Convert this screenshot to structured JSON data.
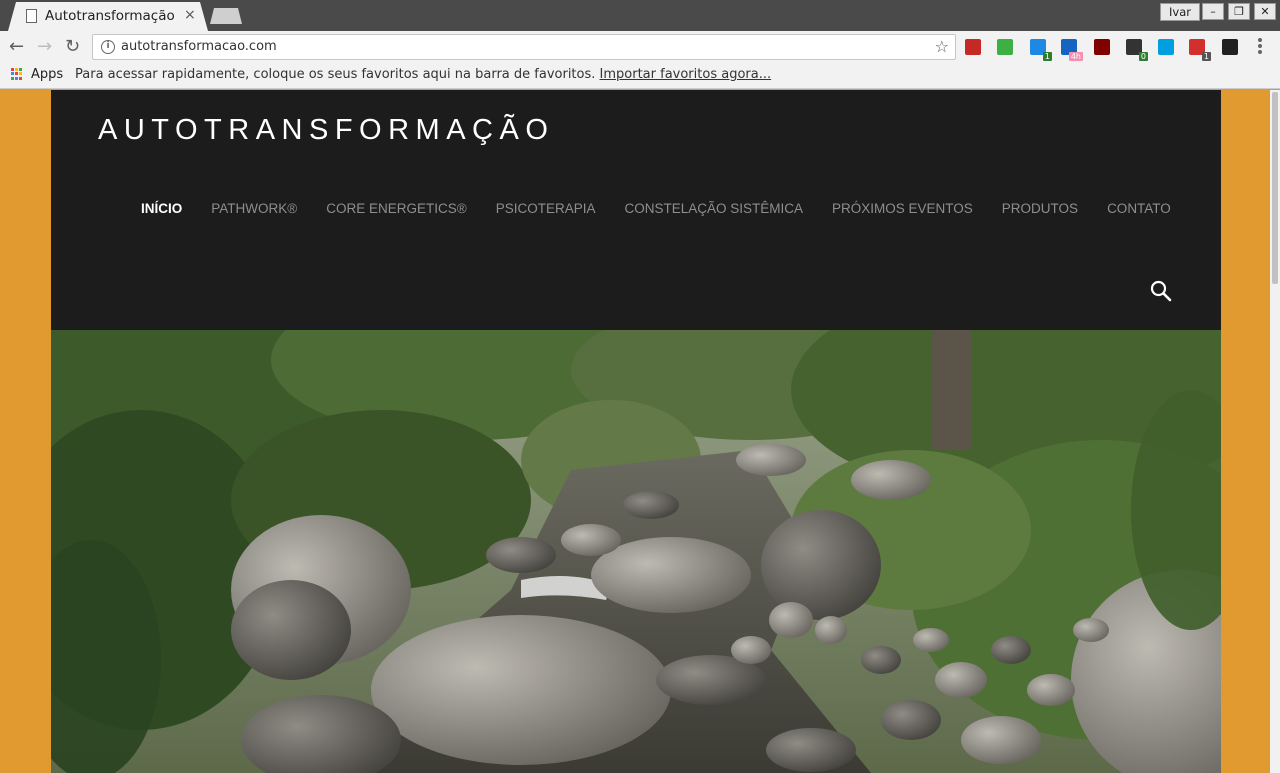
{
  "browser": {
    "tab_title": "Autotransformação",
    "tab_close": "×",
    "profile_name": "Ivar",
    "window_min": "–",
    "window_restore": "❐",
    "window_close": "✕",
    "url": "autotransformacao.com",
    "back_icon": "←",
    "forward_icon": "→",
    "reload_icon": "↻",
    "star_icon": "☆",
    "extensions": [
      {
        "name": "bookmark-ext-icon",
        "color": "#c62828",
        "badge": ""
      },
      {
        "name": "evernote-ext-icon",
        "color": "#3cb043",
        "badge": ""
      },
      {
        "name": "translate-ext-icon",
        "color": "#1e88e5",
        "badge": "1"
      },
      {
        "name": "chat-ext-icon",
        "color": "#1565c0",
        "badge": "4h"
      },
      {
        "name": "ublock-ext-icon",
        "color": "#800000",
        "badge": ""
      },
      {
        "name": "feed-ext-icon",
        "color": "#333333",
        "badge": "0"
      },
      {
        "name": "skype-ext-icon",
        "color": "#00a0e0",
        "badge": ""
      },
      {
        "name": "messages-ext-icon",
        "color": "#d32f2f",
        "badge": "1"
      },
      {
        "name": "share-ext-icon",
        "color": "#222222",
        "badge": ""
      }
    ]
  },
  "bookmarks_bar": {
    "apps_label": "Apps",
    "hint": "Para acessar rapidamente, coloque os seus favoritos aqui na barra de favoritos.",
    "import_link": "Importar favoritos agora..."
  },
  "site": {
    "title": "AUTOTRANSFORMAÇÃO",
    "nav": [
      {
        "label": "INÍCIO",
        "active": true
      },
      {
        "label": "PATHWORK®",
        "active": false
      },
      {
        "label": "CORE ENERGETICS®",
        "active": false
      },
      {
        "label": "PSICOTERAPIA",
        "active": false
      },
      {
        "label": "CONSTELAÇÃO SISTÊMICA",
        "active": false
      },
      {
        "label": "PRÓXIMOS EVENTOS",
        "active": false
      },
      {
        "label": "PRODUTOS",
        "active": false
      },
      {
        "label": "CONTATO",
        "active": false
      }
    ],
    "search_icon": "search-icon",
    "colors": {
      "page_background": "#e09a30",
      "header_background": "#1c1c1d",
      "nav_active": "#ffffff",
      "nav_inactive": "#8e8e8e"
    }
  }
}
